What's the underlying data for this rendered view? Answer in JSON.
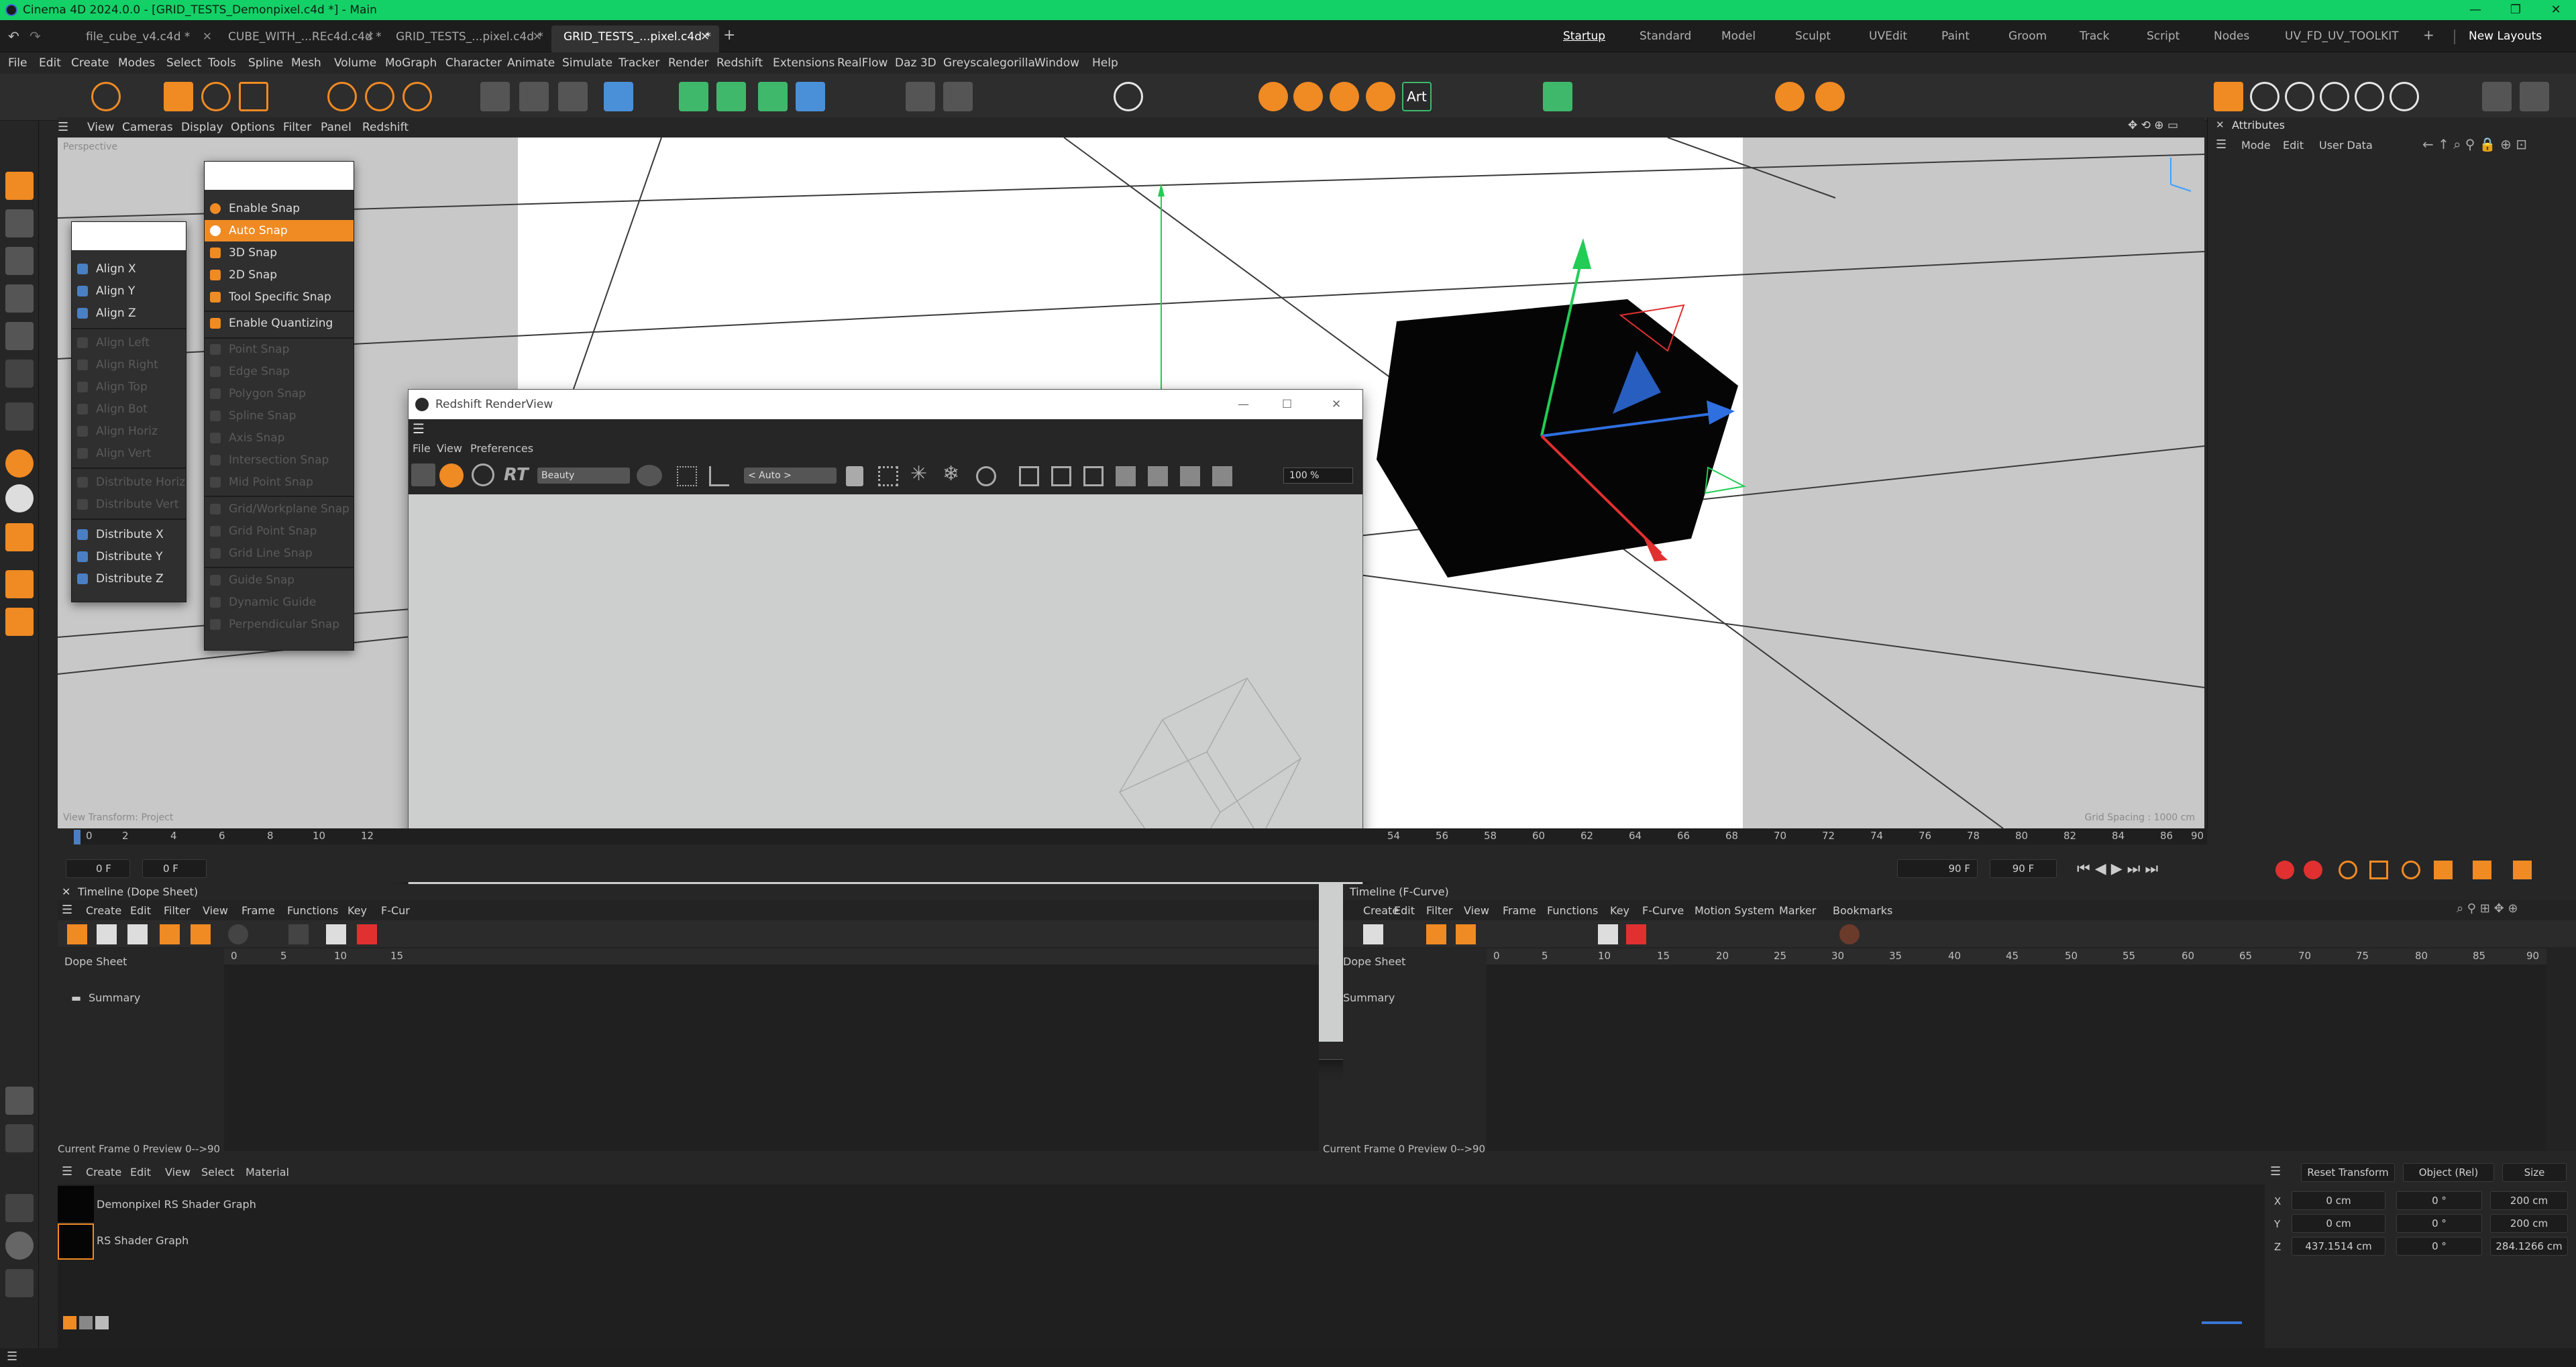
{
  "window": {
    "title": "Cinema 4D 2024.0.0 - [GRID_TESTS_Demonpixel.c4d *] - Main",
    "controls": [
      "—",
      "❐",
      "✕"
    ]
  },
  "doc_tabs": [
    {
      "label": "file_cube_v4.c4d *",
      "active": false
    },
    {
      "label": "CUBE_WITH_...REc4d.c4d *",
      "active": false
    },
    {
      "label": "GRID_TESTS_...pixel.c4d *",
      "active": false
    },
    {
      "label": "GRID_TESTS_...pixel.c4d *",
      "active": true
    }
  ],
  "tab_add": "+",
  "layouts": {
    "items": [
      "Startup",
      "Standard",
      "Model",
      "Sculpt",
      "UVEdit",
      "Paint",
      "Groom",
      "Track",
      "Script",
      "Nodes",
      "UV_FD_UV_TOOLKIT"
    ],
    "active": "Startup",
    "new_layouts": "New Layouts",
    "plus": "+"
  },
  "menubar": [
    "File",
    "Edit",
    "Create",
    "Modes",
    "Select",
    "Tools",
    "Spline",
    "Mesh",
    "Volume",
    "MoGraph",
    "Character",
    "Animate",
    "Simulate",
    "Tracker",
    "Render",
    "Redshift",
    "Extensions",
    "RealFlow",
    "Daz 3D",
    "Greyscalegorilla",
    "Window",
    "Help"
  ],
  "toolbar": {
    "art_label": "Art",
    "rt_label": "RT"
  },
  "viewport_menu": [
    "View",
    "Cameras",
    "Display",
    "Options",
    "Filter",
    "Panel",
    "Redshift"
  ],
  "viewport": {
    "hud_bottom_left": "View Transform: Project",
    "hud_bottom_right": "Grid Spacing : 1000 cm",
    "hud_top_left": "Perspective"
  },
  "align_menu": {
    "items": [
      {
        "label": "Align X",
        "enabled": true
      },
      {
        "label": "Align Y",
        "enabled": true
      },
      {
        "label": "Align Z",
        "enabled": true
      },
      {
        "label": "Align Left",
        "enabled": false
      },
      {
        "label": "Align Right",
        "enabled": false
      },
      {
        "label": "Align Top",
        "enabled": false
      },
      {
        "label": "Align Bot",
        "enabled": false
      },
      {
        "label": "Align Horiz",
        "enabled": false
      },
      {
        "label": "Align Vert",
        "enabled": false
      },
      {
        "label": "Distribute Horiz",
        "enabled": false
      },
      {
        "label": "Distribute Vert",
        "enabled": false
      },
      {
        "label": "Distribute X",
        "enabled": true
      },
      {
        "label": "Distribute Y",
        "enabled": true
      },
      {
        "label": "Distribute Z",
        "enabled": true
      }
    ]
  },
  "snap_menu": {
    "items": [
      {
        "label": "Enable Snap",
        "enabled": true
      },
      {
        "label": "Auto Snap",
        "enabled": true,
        "highlighted": true
      },
      {
        "label": "3D Snap",
        "enabled": true
      },
      {
        "label": "2D Snap",
        "enabled": true
      },
      {
        "label": "Tool Specific Snap",
        "enabled": true
      },
      {
        "label": "Enable Quantizing",
        "enabled": true
      },
      {
        "label": "Point Snap",
        "enabled": false
      },
      {
        "label": "Edge Snap",
        "enabled": false
      },
      {
        "label": "Polygon Snap",
        "enabled": false
      },
      {
        "label": "Spline Snap",
        "enabled": false
      },
      {
        "label": "Axis Snap",
        "enabled": false
      },
      {
        "label": "Intersection Snap",
        "enabled": false
      },
      {
        "label": "Mid Point Snap",
        "enabled": false
      },
      {
        "label": "Grid/Workplane Snap",
        "enabled": false
      },
      {
        "label": "Grid Point Snap",
        "enabled": false
      },
      {
        "label": "Grid Line Snap",
        "enabled": false
      },
      {
        "label": "Guide Snap",
        "enabled": false
      },
      {
        "label": "Dynamic Guide",
        "enabled": false
      },
      {
        "label": "Perpendicular Snap",
        "enabled": false
      }
    ]
  },
  "render_view": {
    "title": "Redshift RenderView",
    "menu": [
      "File",
      "View",
      "Preferences"
    ],
    "aov": "Beauty",
    "camera": "< Auto >",
    "zoom": "100 %",
    "rt_label": "RT"
  },
  "timeline": {
    "start_field": "0 F",
    "current_field": "0 F",
    "end_field": "90 F",
    "end_field2": "90 F",
    "frame_right": "0 F",
    "ticks": [
      "0",
      "2",
      "4",
      "6",
      "8",
      "10",
      "12",
      "54",
      "56",
      "58",
      "60",
      "62",
      "64",
      "66",
      "68",
      "70",
      "72",
      "74",
      "76",
      "78",
      "80",
      "82",
      "84",
      "86",
      "88",
      "90"
    ]
  },
  "dope_sheet": {
    "title": "Timeline (Dope Sheet)",
    "menu": [
      "Create",
      "Edit",
      "Filter",
      "View",
      "Frame",
      "Functions",
      "Key",
      "F-Cur"
    ],
    "tree_header": "Dope Sheet",
    "tree_items": [
      "Summary"
    ],
    "ruler": [
      "0",
      "5",
      "10",
      "15"
    ],
    "status": "Current Frame  0  Preview  0-->90"
  },
  "fcurve": {
    "title": "Timeline (F-Curve)",
    "menu": [
      "Create",
      "Edit",
      "Filter",
      "View",
      "Frame",
      "Functions",
      "Key",
      "F-Curve",
      "Motion System",
      "Marker",
      "Bookmarks"
    ],
    "tree_header": "Dope Sheet",
    "tree_items": [
      "Summary"
    ],
    "ruler": [
      "0",
      "5",
      "10",
      "15",
      "20",
      "25",
      "30",
      "35",
      "40",
      "45",
      "50",
      "55",
      "60",
      "65",
      "70",
      "75",
      "80",
      "85",
      "90"
    ],
    "status": "Current Frame  0  Preview  0-->90"
  },
  "material_manager": {
    "menu": [
      "Create",
      "Edit",
      "View",
      "Select",
      "Material"
    ],
    "materials": [
      "Demonpixel RS Shader Graph",
      "RS Shader Graph"
    ]
  },
  "coordinates": {
    "reset": "Reset Transform",
    "mode": "Object (Rel)",
    "size_mode": "Size",
    "rows": [
      {
        "axis": "X",
        "pos": "0 cm",
        "rot": "0 °",
        "size": "200 cm"
      },
      {
        "axis": "Y",
        "pos": "0 cm",
        "rot": "0 °",
        "size": "200 cm"
      },
      {
        "axis": "Z",
        "pos": "437.1514 cm",
        "rot": "0 °",
        "size": "284.1266 cm"
      }
    ]
  },
  "attributes": {
    "title": "Attributes",
    "menu": [
      "Mode",
      "Edit",
      "User Data"
    ]
  },
  "colors": {
    "accent": "#f08a23",
    "titlebar": "#14d167",
    "viewport_bg": "#c8c8c8",
    "axis_x": "#e03030",
    "axis_y": "#22cc55",
    "axis_z": "#2f6fe0"
  }
}
